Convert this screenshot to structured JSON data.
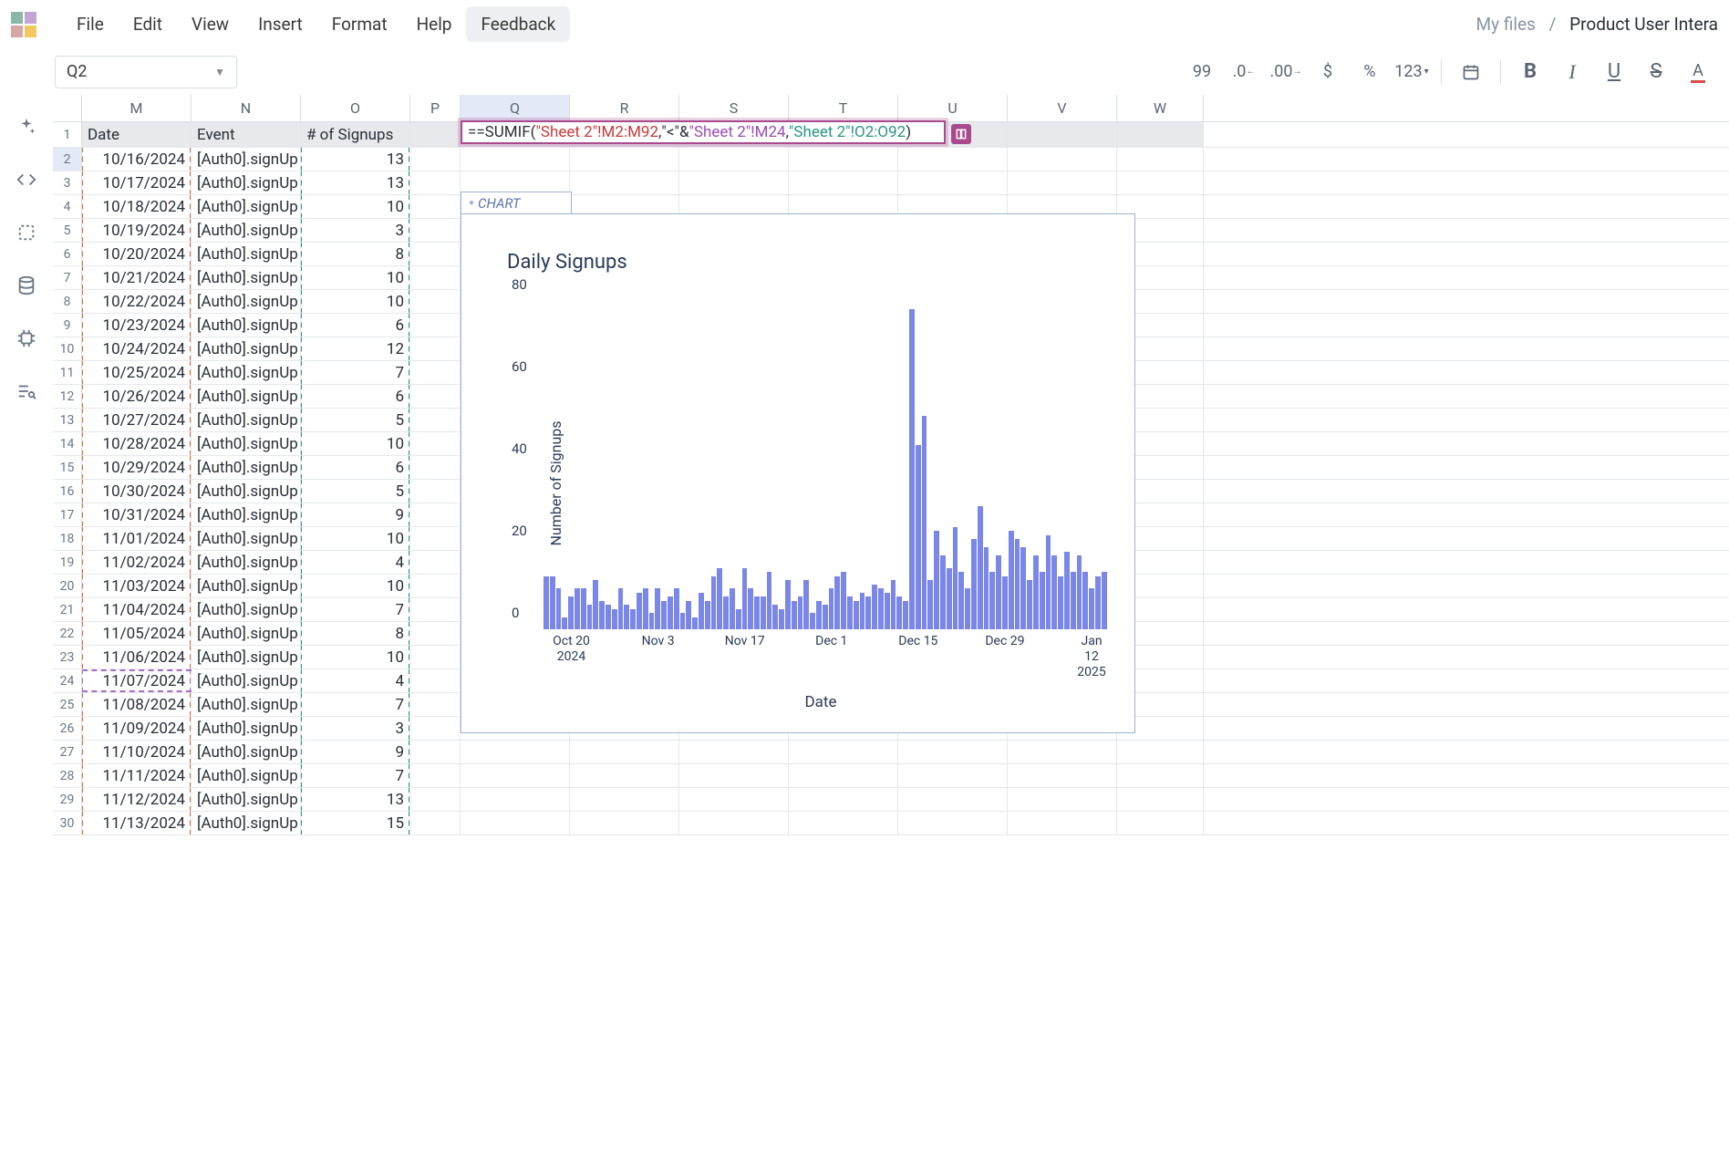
{
  "menu": {
    "file": "File",
    "edit": "Edit",
    "view": "View",
    "insert": "Insert",
    "format": "Format",
    "help": "Help",
    "feedback": "Feedback"
  },
  "breadcrumb": {
    "myfiles": "My files",
    "sep": "/",
    "current": "Product User Intera"
  },
  "cellref": "Q2",
  "toolbar": {
    "num": "99",
    "decdec": ".0",
    "decinc": ".00",
    "currency": "$",
    "percent": "%",
    "numfmt": "123",
    "bold": "B",
    "italic": "I",
    "under": "U",
    "strike": "S",
    "color": "A"
  },
  "columns": [
    "M",
    "N",
    "O",
    "P",
    "Q",
    "R",
    "S",
    "T",
    "U",
    "V",
    "W"
  ],
  "headerRow": {
    "date": "Date",
    "event": "Event",
    "signups": "# of Signups"
  },
  "formula": {
    "p1": "==SUMIF(",
    "r1": "\"Sheet 2\"!M2:M92",
    "c1": ", ",
    "q": "\"<\"",
    "amp": "&",
    "r2": "\"Sheet 2\"!M24",
    "c2": ", ",
    "r3": "\"Sheet 2\"!O2:O92",
    "p2": ")"
  },
  "rows": [
    {
      "n": 1,
      "header": true
    },
    {
      "n": 2,
      "date": "10/16/2024",
      "event": "[Auth0].signUp",
      "v": "13"
    },
    {
      "n": 3,
      "date": "10/17/2024",
      "event": "[Auth0].signUp",
      "v": "13"
    },
    {
      "n": 4,
      "date": "10/18/2024",
      "event": "[Auth0].signUp",
      "v": "10"
    },
    {
      "n": 5,
      "date": "10/19/2024",
      "event": "[Auth0].signUp",
      "v": "3"
    },
    {
      "n": 6,
      "date": "10/20/2024",
      "event": "[Auth0].signUp",
      "v": "8"
    },
    {
      "n": 7,
      "date": "10/21/2024",
      "event": "[Auth0].signUp",
      "v": "10"
    },
    {
      "n": 8,
      "date": "10/22/2024",
      "event": "[Auth0].signUp",
      "v": "10"
    },
    {
      "n": 9,
      "date": "10/23/2024",
      "event": "[Auth0].signUp",
      "v": "6"
    },
    {
      "n": 10,
      "date": "10/24/2024",
      "event": "[Auth0].signUp",
      "v": "12"
    },
    {
      "n": 11,
      "date": "10/25/2024",
      "event": "[Auth0].signUp",
      "v": "7"
    },
    {
      "n": 12,
      "date": "10/26/2024",
      "event": "[Auth0].signUp",
      "v": "6"
    },
    {
      "n": 13,
      "date": "10/27/2024",
      "event": "[Auth0].signUp",
      "v": "5"
    },
    {
      "n": 14,
      "date": "10/28/2024",
      "event": "[Auth0].signUp",
      "v": "10"
    },
    {
      "n": 15,
      "date": "10/29/2024",
      "event": "[Auth0].signUp",
      "v": "6"
    },
    {
      "n": 16,
      "date": "10/30/2024",
      "event": "[Auth0].signUp",
      "v": "5"
    },
    {
      "n": 17,
      "date": "10/31/2024",
      "event": "[Auth0].signUp",
      "v": "9"
    },
    {
      "n": 18,
      "date": "11/01/2024",
      "event": "[Auth0].signUp",
      "v": "10"
    },
    {
      "n": 19,
      "date": "11/02/2024",
      "event": "[Auth0].signUp",
      "v": "4"
    },
    {
      "n": 20,
      "date": "11/03/2024",
      "event": "[Auth0].signUp",
      "v": "10"
    },
    {
      "n": 21,
      "date": "11/04/2024",
      "event": "[Auth0].signUp",
      "v": "7"
    },
    {
      "n": 22,
      "date": "11/05/2024",
      "event": "[Auth0].signUp",
      "v": "8"
    },
    {
      "n": 23,
      "date": "11/06/2024",
      "event": "[Auth0].signUp",
      "v": "10"
    },
    {
      "n": 24,
      "date": "11/07/2024",
      "event": "[Auth0].signUp",
      "v": "4"
    },
    {
      "n": 25,
      "date": "11/08/2024",
      "event": "[Auth0].signUp",
      "v": "7"
    },
    {
      "n": 26,
      "date": "11/09/2024",
      "event": "[Auth0].signUp",
      "v": "3"
    },
    {
      "n": 27,
      "date": "11/10/2024",
      "event": "[Auth0].signUp",
      "v": "9"
    },
    {
      "n": 28,
      "date": "11/11/2024",
      "event": "[Auth0].signUp",
      "v": "7"
    },
    {
      "n": 29,
      "date": "11/12/2024",
      "event": "[Auth0].signUp",
      "v": "13"
    },
    {
      "n": 30,
      "date": "11/13/2024",
      "event": "[Auth0].signUp",
      "v": "15"
    }
  ],
  "chart": {
    "tab": "CHART",
    "title": "Daily Signups",
    "ylabel": "Number of Signups",
    "xlabel": "Date"
  },
  "chart_data": {
    "type": "bar",
    "title": "Daily Signups",
    "xlabel": "Date",
    "ylabel": "Number of Signups",
    "ylim": [
      0,
      80
    ],
    "yticks": [
      0,
      20,
      40,
      60,
      80
    ],
    "xticks": [
      "Oct 20\n2024",
      "Nov 3",
      "Nov 17",
      "Dec 1",
      "Dec 15",
      "Dec 29",
      "Jan 12\n2025"
    ],
    "categories_start": "2024-10-16",
    "categories_end": "2025-01-14",
    "values": [
      13,
      13,
      10,
      3,
      8,
      10,
      10,
      6,
      12,
      7,
      6,
      5,
      10,
      6,
      5,
      9,
      10,
      4,
      10,
      7,
      8,
      10,
      4,
      7,
      3,
      9,
      7,
      13,
      15,
      8,
      10,
      5,
      15,
      10,
      8,
      8,
      14,
      6,
      5,
      12,
      7,
      8,
      12,
      4,
      7,
      6,
      10,
      13,
      14,
      8,
      7,
      9,
      8,
      11,
      10,
      9,
      12,
      8,
      7,
      78,
      45,
      52,
      12,
      24,
      18,
      15,
      25,
      14,
      10,
      22,
      30,
      20,
      14,
      18,
      13,
      24,
      22,
      20,
      12,
      18,
      14,
      23,
      18,
      13,
      19,
      14,
      18,
      14,
      10,
      13,
      14
    ]
  }
}
